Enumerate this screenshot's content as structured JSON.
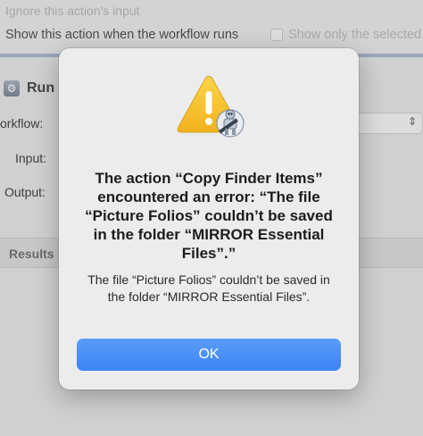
{
  "background": {
    "ignore_input_label": "Ignore this action's input",
    "show_action_label": "Show this action when the workflow runs",
    "show_only_selected_label": "Show only the selected",
    "run_label": "Run",
    "workflow_label": "orkflow:",
    "input_label": "Input:",
    "output_label": "Output:",
    "results_label": "Results"
  },
  "dialog": {
    "icon": "caution-triangle-with-automator-robot-icon",
    "title": "The action “Copy Finder Items” encountered an error: “The file “Picture Folios” couldn’t be saved in the folder “MIRROR Essential Files”.”",
    "message": "The file “Picture Folios” couldn’t be saved in the folder “MIRROR Essential Files”.",
    "ok_label": "OK"
  },
  "colors": {
    "accent": "#3b84f6",
    "warning_yellow": "#f7c331"
  }
}
